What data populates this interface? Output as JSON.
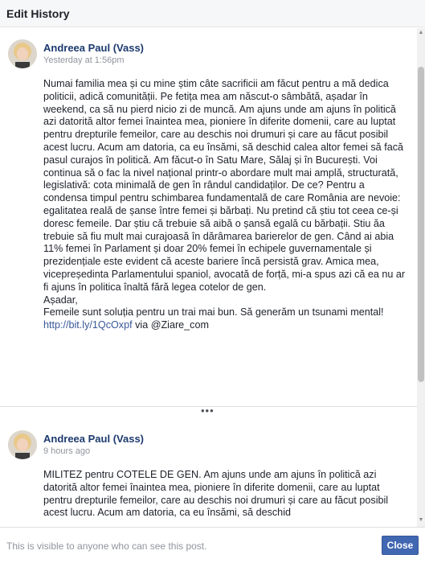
{
  "dialog": {
    "title": "Edit History",
    "footer_note": "This is visible to anyone who can see this post.",
    "close_label": "Close"
  },
  "posts": [
    {
      "author": "Andreea Paul (Vass)",
      "time": "Yesterday at 1:56pm",
      "paragraphs": [
        "Numai familia mea și cu mine știm câte sacrificii am făcut pentru a mă dedica politicii, adică comunității. Pe fetița mea am născut-o sâmbătă, așadar în weekend, ca să nu pierd nicio zi de muncă. Am ajuns unde am ajuns în politică azi datorită altor femei înaintea mea, pioniere în diferite domenii, care au luptat pentru drepturile femeilor, care au deschis noi drumuri și care au făcut posibil acest lucru. Acum am datoria, ca eu însămi, să deschid calea altor femei să facă pasul curajos în politică. Am făcut-o în Satu Mare, Sălaj și în București. Voi continua să o fac la nivel național printr-o abordare mult mai amplă, structurată, legislativă: cota minimală de gen în rândul candidaților. De ce? Pentru a condensa timpul pentru schimbarea fundamentală de care România are nevoie: egalitatea reală de șanse între femei și bărbați. Nu pretind că știu tot ceea ce-și doresc femeile. Dar știu că trebuie să aibă o șansă egală cu bărbații. Stiu ăa trebuie să fiu mult mai curajoasă în dărâmarea barierelor de gen. Când ai abia 11% femei în Parlament și doar 20% femei în echipele guvernamentale și prezidențiale este evident că aceste bariere încă persistă grav. Amica mea, vicepreședinta Parlamentului spaniol, avocată de forță, mi-a spus azi că ea nu ar fi ajuns în politica înaltă fără legea cotelor de gen.",
        "Așadar,"
      ],
      "last_line_pre": "Femeile sunt soluția pentru un trai mai bun. Să generăm un tsunami mental! ",
      "link": "http://bit.ly/1QcOxpf",
      "last_line_post": " via @Ziare_com"
    },
    {
      "author": "Andreea Paul (Vass)",
      "time": "9 hours ago",
      "paragraphs": [
        "MILITEZ pentru COTELE DE GEN. Am ajuns unde am ajuns în politică azi datorită altor femei înaintea mea, pioniere în diferite domenii, care au luptat pentru drepturile femeilor, care au deschis noi drumuri și care au făcut posibil acest lucru. Acum am datoria, ca eu însămi, să deschid"
      ]
    }
  ],
  "separator_label": "•••"
}
